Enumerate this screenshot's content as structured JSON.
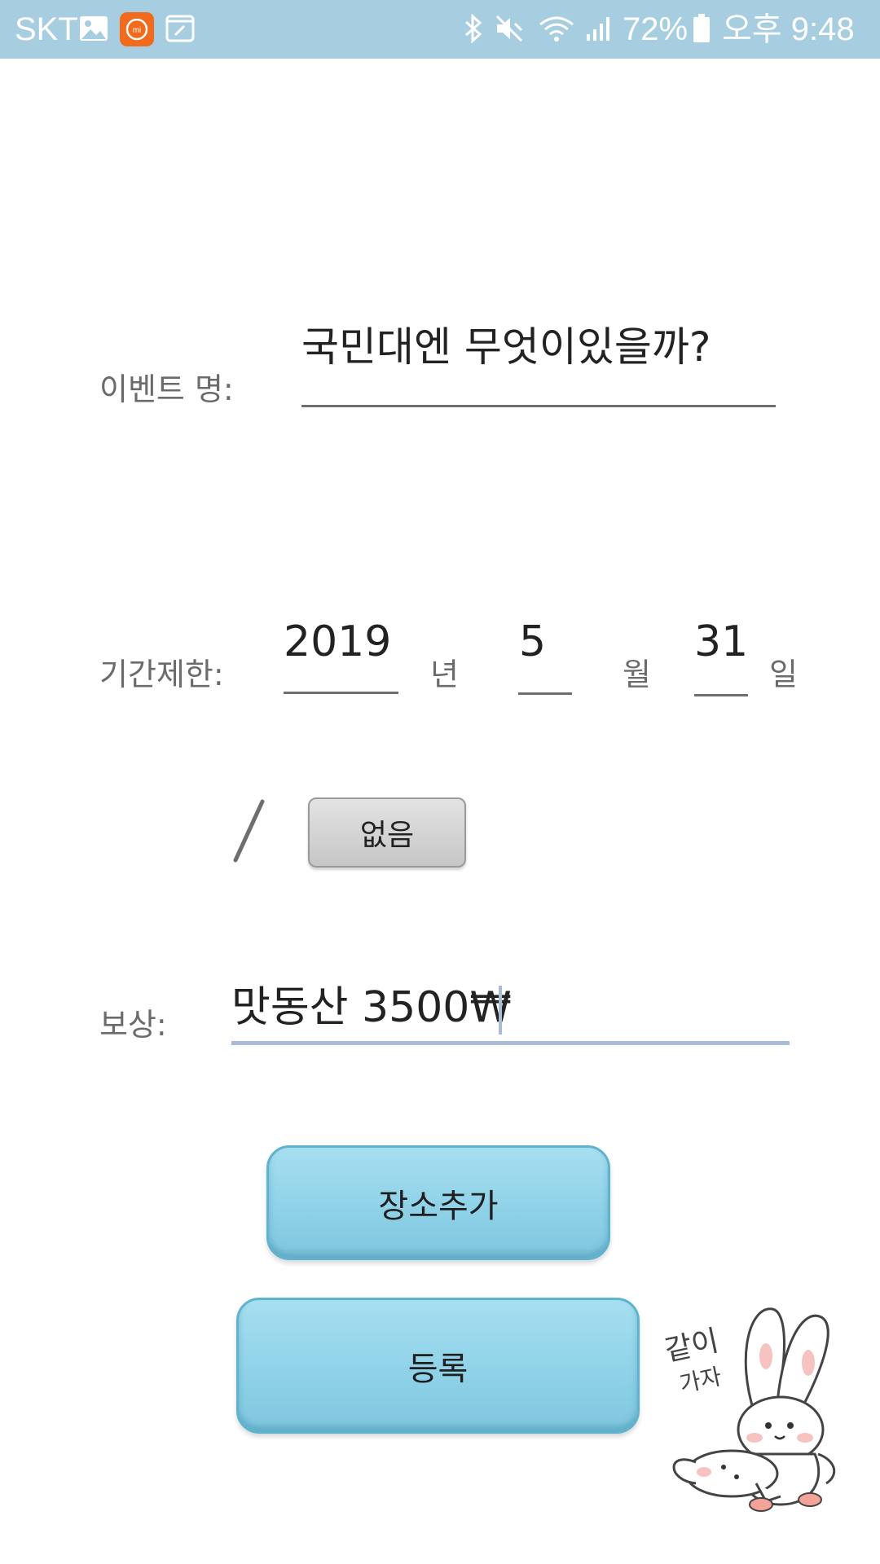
{
  "status_bar": {
    "carrier": "SKT",
    "battery": "72%",
    "time": "오후 9:48",
    "icons": [
      "gallery-icon",
      "mi-app-icon",
      "note-icon",
      "bluetooth-icon",
      "mute-icon",
      "wifi-icon",
      "signal-icon",
      "battery-icon"
    ]
  },
  "event_name": {
    "label": "이벤트 명:",
    "value": "국민대엔 무엇이있을까?"
  },
  "period": {
    "label": "기간제한:",
    "year": "2019",
    "year_unit": "년",
    "month": "5",
    "month_unit": "월",
    "day": "31",
    "day_unit": "일",
    "separator": "/",
    "none_button": "없음"
  },
  "reward": {
    "label": "보상:",
    "value": "맛동산 3500₩"
  },
  "buttons": {
    "add_place": "장소추가",
    "register": "등록"
  },
  "sticker": {
    "text_line1": "같이",
    "text_line2": "가자"
  },
  "colors": {
    "status_bar": "#a7cee0",
    "button_blue": "#92d4ea",
    "input_active_line": "#a9bcd6"
  }
}
